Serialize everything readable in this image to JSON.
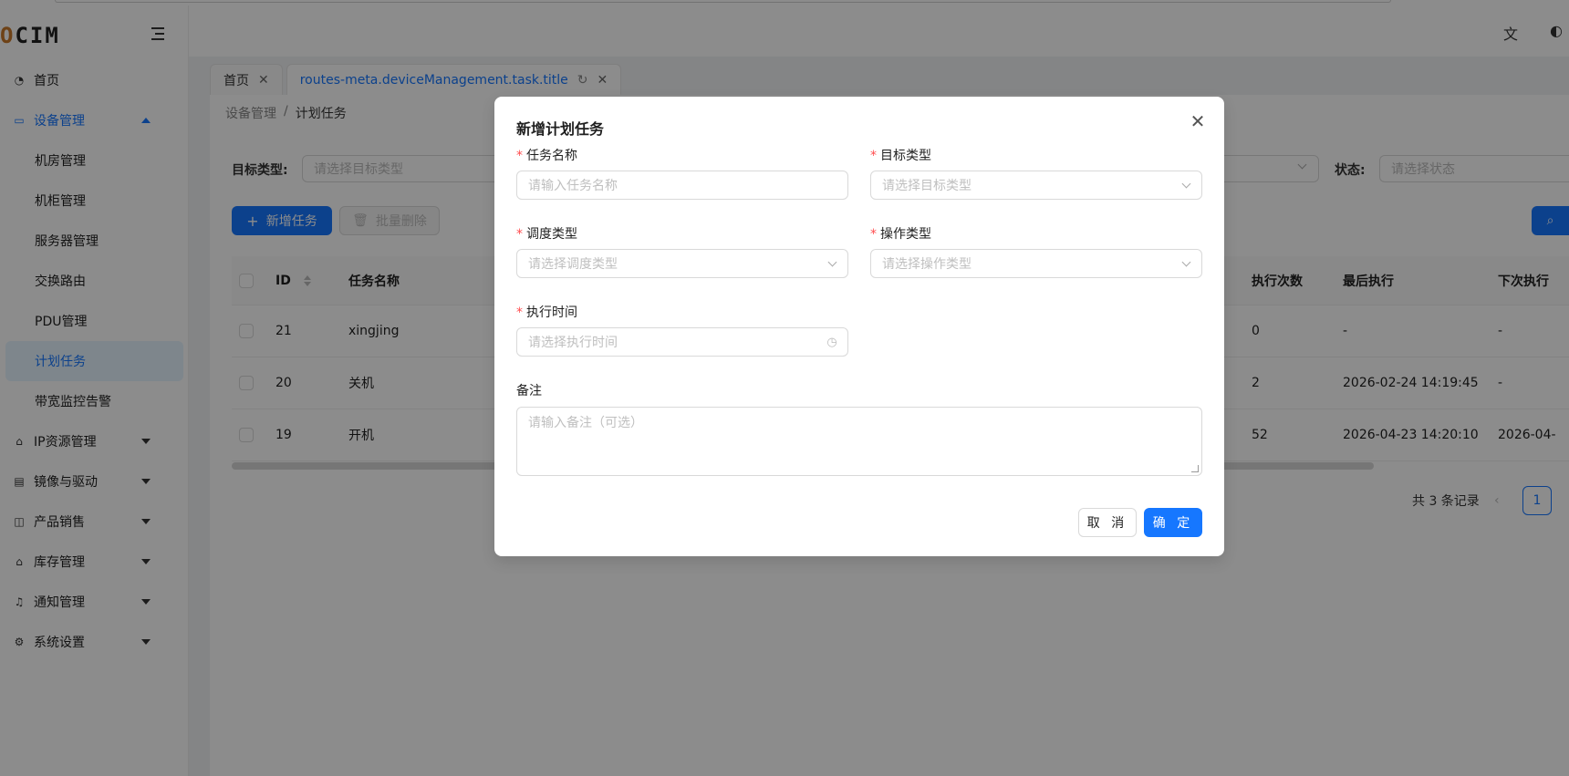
{
  "app": {
    "logo_prefix": "O",
    "logo_text": "CIM"
  },
  "sidebar": {
    "items": [
      {
        "label": "首页",
        "icon": "dashboard-icon"
      },
      {
        "label": "设备管理",
        "icon": "monitor-icon",
        "open": true,
        "children": [
          "机房管理",
          "机柜管理",
          "服务器管理",
          "交换路由",
          "PDU管理",
          "计划任务",
          "带宽监控告警"
        ],
        "active_child": "计划任务"
      },
      {
        "label": "IP资源管理",
        "icon": "network-icon"
      },
      {
        "label": "镜像与驱动",
        "icon": "image-icon"
      },
      {
        "label": "产品销售",
        "icon": "bag-icon"
      },
      {
        "label": "库存管理",
        "icon": "warehouse-icon"
      },
      {
        "label": "通知管理",
        "icon": "bell-icon"
      },
      {
        "label": "系统设置",
        "icon": "gear-icon"
      }
    ]
  },
  "tabs": [
    {
      "label": "首页",
      "active": false
    },
    {
      "label": "routes-meta.deviceManagement.task.title",
      "active": true
    }
  ],
  "breadcrumb": {
    "parent": "设备管理",
    "sep": "/",
    "current": "计划任务"
  },
  "filters": {
    "target_type_label": "目标类型:",
    "target_type_placeholder": "请选择目标类型",
    "status_label": "状态:",
    "status_placeholder": "请选择状态"
  },
  "toolbar": {
    "add_label": "新增任务",
    "batch_delete_label": "批量删除"
  },
  "table": {
    "columns": [
      "ID",
      "任务名称",
      "执行次数",
      "最后执行",
      "下次执行"
    ],
    "rows": [
      {
        "id": "21",
        "name": "xingjing",
        "count": "0",
        "last": "-",
        "next": "-"
      },
      {
        "id": "20",
        "name": "关机",
        "count": "2",
        "last": "2026-02-24 14:19:45",
        "next": "-"
      },
      {
        "id": "19",
        "name": "开机",
        "count": "52",
        "last": "2026-04-23 14:20:10",
        "next": "2026-04-"
      }
    ]
  },
  "pagination": {
    "total_text": "共 3 条记录",
    "current_page": "1"
  },
  "modal": {
    "title": "新增计划任务",
    "fields": {
      "task_name": {
        "label": "任务名称",
        "placeholder": "请输入任务名称"
      },
      "target_type": {
        "label": "目标类型",
        "placeholder": "请选择目标类型"
      },
      "schedule_type": {
        "label": "调度类型",
        "placeholder": "请选择调度类型"
      },
      "operation_type": {
        "label": "操作类型",
        "placeholder": "请选择操作类型"
      },
      "exec_time": {
        "label": "执行时间",
        "placeholder": "请选择执行时间"
      },
      "remark": {
        "label": "备注",
        "placeholder": "请输入备注（可选）"
      }
    },
    "required_mark": "*",
    "cancel_label": "取 消",
    "ok_label": "确 定"
  },
  "colors": {
    "primary": "#1677ff",
    "required": "#ff4d4f",
    "mask": "rgba(0,0,0,0.45)"
  }
}
